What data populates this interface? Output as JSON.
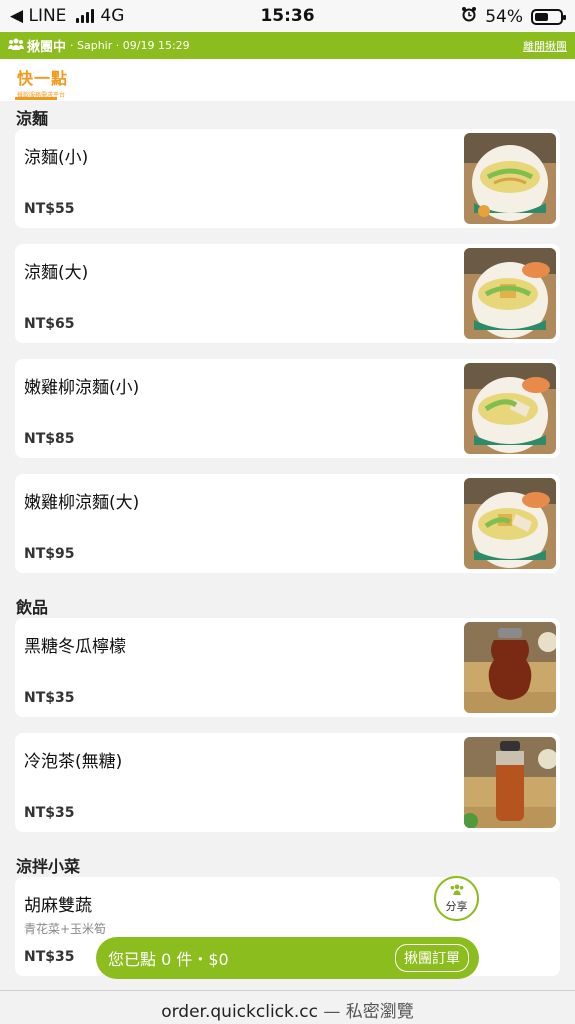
{
  "status_bar": {
    "back_app": "◀ LINE",
    "network": "4G",
    "time": "15:36",
    "battery": "54%",
    "battery_level": 0.54
  },
  "group_bar": {
    "status": "揪團中",
    "info": "· Saphir · 09/19 15:29",
    "leave_label": "離開揪團"
  },
  "logo": {
    "name": "快一點",
    "tagline": "餐飲服務需求平台"
  },
  "sections": [
    {
      "title": "涼麵",
      "items": [
        {
          "name": "涼麵(小)",
          "description": "",
          "price": "NT$55"
        },
        {
          "name": "涼麵(大)",
          "description": "",
          "price": "NT$65"
        },
        {
          "name": "嫩雞柳涼麵(小)",
          "description": "",
          "price": "NT$85"
        },
        {
          "name": "嫩雞柳涼麵(大)",
          "description": "",
          "price": "NT$95"
        }
      ]
    },
    {
      "title": "飲品",
      "items": [
        {
          "name": "黑糖冬瓜檸檬",
          "description": "",
          "price": "NT$35"
        },
        {
          "name": "冷泡茶(無糖)",
          "description": "",
          "price": "NT$35"
        }
      ]
    },
    {
      "title": "涼拌小菜",
      "items": [
        {
          "name": "胡麻雙蔬",
          "description": "青花菜+玉米筍",
          "price": "NT$35"
        }
      ]
    }
  ],
  "share_button": {
    "label": "分享"
  },
  "cart_bar": {
    "summary": "您已點 0 件・$0",
    "order_label": "揪團訂單"
  },
  "browser": {
    "url": "order.quickclick.cc",
    "mode": " — 私密瀏覽"
  },
  "colors": {
    "brand_green": "#8cbd1e",
    "brand_orange": "#f39a1e"
  }
}
